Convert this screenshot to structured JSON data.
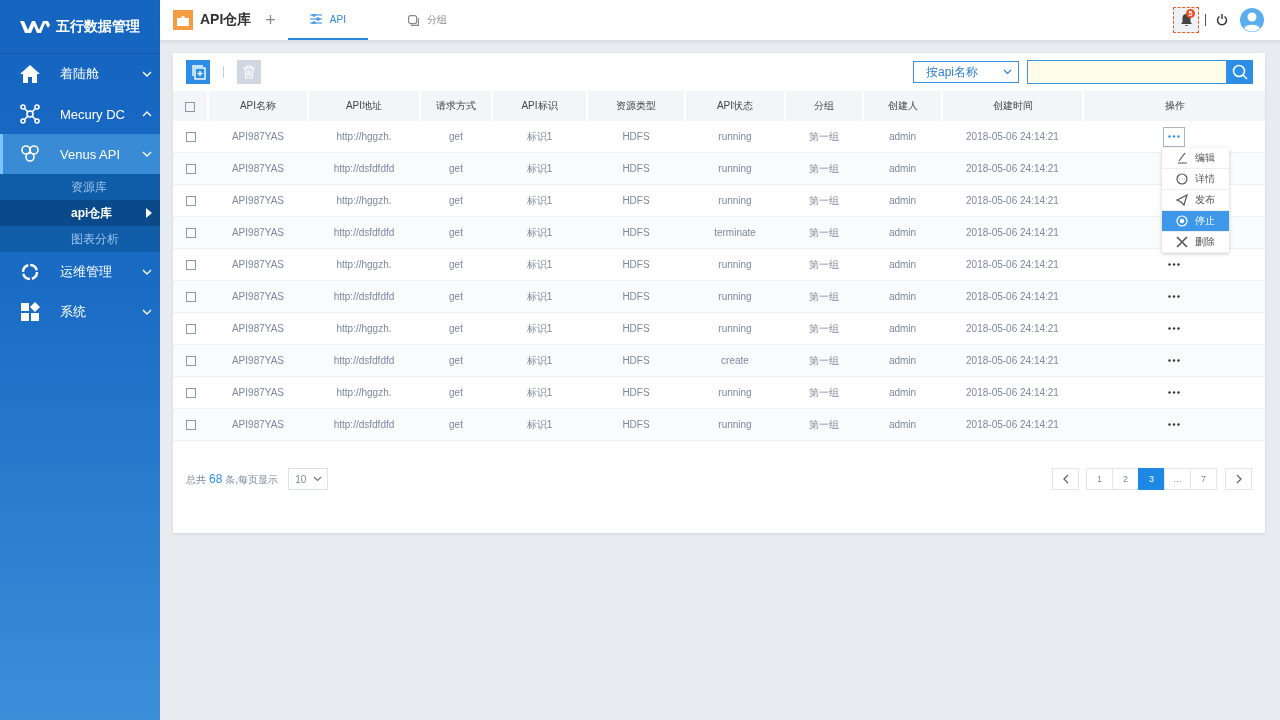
{
  "app": {
    "title": "五行数据管理"
  },
  "sidebar": {
    "items": [
      {
        "label": "着陆舱",
        "expanded": false,
        "selected": false
      },
      {
        "label": "Mecury DC",
        "expanded": true,
        "selected": false
      },
      {
        "label": "Venus API",
        "expanded": false,
        "selected": true,
        "children": [
          {
            "label": "资源库",
            "selected": false
          },
          {
            "label": "api仓库",
            "selected": true
          },
          {
            "label": "图表分析",
            "selected": false
          }
        ]
      },
      {
        "label": "运维管理",
        "expanded": false,
        "selected": false
      },
      {
        "label": "系统",
        "expanded": false,
        "selected": false
      }
    ]
  },
  "topbar": {
    "page_title": "API仓库",
    "add": "+",
    "tabs": [
      {
        "label": "API",
        "selected": true
      },
      {
        "label": "分组",
        "selected": false
      }
    ],
    "notifications": {
      "count": "5"
    }
  },
  "toolbar": {
    "filter": "按api名称"
  },
  "table": {
    "header_checked": false,
    "columns": [
      "API名称",
      "API地址",
      "请求方式",
      "API标识",
      "资源类型",
      "API状态",
      "分组",
      "创建人",
      "创建时间",
      "操作"
    ],
    "rows": [
      {
        "checked": false,
        "menu_open": true,
        "cells": [
          "API987YAS",
          "http://hggzh.",
          "get",
          "标识1",
          "HDFS",
          "running",
          "第一组",
          "admin",
          "2018-05-06  24:14:21"
        ]
      },
      {
        "checked": false,
        "cells": [
          "API987YAS",
          "http://dsfdfdfd",
          "get",
          "标识1",
          "HDFS",
          "running",
          "第一组",
          "admin",
          "2018-05-06  24:14:21"
        ]
      },
      {
        "checked": false,
        "cells": [
          "API987YAS",
          "http://hggzh.",
          "get",
          "标识1",
          "HDFS",
          "running",
          "第一组",
          "admin",
          "2018-05-06  24:14:21"
        ]
      },
      {
        "checked": false,
        "cells": [
          "API987YAS",
          "http://dsfdfdfd",
          "get",
          "标识1",
          "HDFS",
          "terminate",
          "第一组",
          "admin",
          "2018-05-06  24:14:21"
        ]
      },
      {
        "checked": false,
        "menu_open": false,
        "cells": [
          "API987YAS",
          "http://hggzh.",
          "get",
          "标识1",
          "HDFS",
          "running",
          "第一组",
          "admin",
          "2018-05-06  24:14:21"
        ]
      },
      {
        "checked": false,
        "menu_open": false,
        "cells": [
          "API987YAS",
          "http://dsfdfdfd",
          "get",
          "标识1",
          "HDFS",
          "running",
          "第一组",
          "admin",
          "2018-05-06  24:14:21"
        ]
      },
      {
        "checked": false,
        "menu_open": false,
        "cells": [
          "API987YAS",
          "http://hggzh.",
          "get",
          "标识1",
          "HDFS",
          "running",
          "第一组",
          "admin",
          "2018-05-06  24:14:21"
        ]
      },
      {
        "checked": false,
        "menu_open": false,
        "cells": [
          "API987YAS",
          "http://dsfdfdfd",
          "get",
          "标识1",
          "HDFS",
          "create",
          "第一组",
          "admin",
          "2018-05-06  24:14:21"
        ]
      },
      {
        "checked": false,
        "menu_open": false,
        "cells": [
          "API987YAS",
          "http://hggzh.",
          "get",
          "标识1",
          "HDFS",
          "running",
          "第一组",
          "admin",
          "2018-05-06  24:14:21"
        ]
      },
      {
        "checked": false,
        "menu_open": false,
        "cells": [
          "API987YAS",
          "http://dsfdfdfd",
          "get",
          "标识1",
          "HDFS",
          "running",
          "第一组",
          "admin",
          "2018-05-06  24:14:21"
        ]
      }
    ],
    "action_menu": [
      {
        "kind": "edit",
        "label": "编辑",
        "selected": false
      },
      {
        "kind": "detail",
        "label": "详情",
        "selected": false
      },
      {
        "kind": "publish",
        "label": "发布",
        "selected": false
      },
      {
        "kind": "stop",
        "label": "停止",
        "selected": true
      },
      {
        "kind": "delete",
        "label": "删除",
        "selected": false
      }
    ]
  },
  "pagination": {
    "total_prefix": "总共",
    "total": "68",
    "total_suffix": "条,每页显示",
    "page_size": "10",
    "pages": [
      {
        "label": "1",
        "selected": false
      },
      {
        "label": "2",
        "selected": false
      },
      {
        "label": "3",
        "selected": true
      },
      {
        "label": "…",
        "selected": false
      },
      {
        "label": "7",
        "selected": false
      }
    ]
  }
}
